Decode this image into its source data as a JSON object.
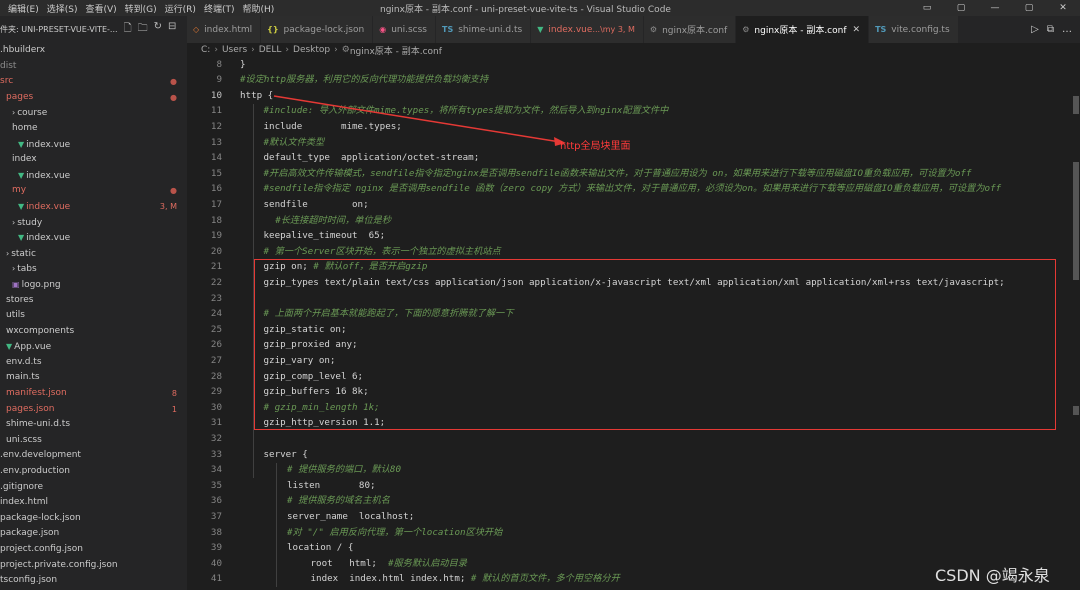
{
  "menu": [
    "编辑(E)",
    "选择(S)",
    "查看(V)",
    "转到(G)",
    "运行(R)",
    "终端(T)",
    "帮助(H)"
  ],
  "window_title": "nginx原本 - 副本.conf - uni-preset-vue-vite-ts - Visual Studio Code",
  "window_controls": [
    "▭",
    "▢",
    "—",
    "▢",
    "✕"
  ],
  "explorer": {
    "header": "件夹: UNI-PRESET-VUE-VITE-...",
    "icons": [
      "new-file-icon",
      "new-folder-icon",
      "refresh-icon",
      "collapse-icon"
    ],
    "items": [
      {
        "label": ".hbuilderx",
        "indent": 0,
        "color": "#cccccc",
        "icon": "",
        "badge": ""
      },
      {
        "label": "dist",
        "indent": 0,
        "color": "#8c8c8c",
        "icon": "",
        "badge": ""
      },
      {
        "label": "src",
        "indent": 0,
        "color": "#e06c60",
        "icon": "",
        "badge": "●",
        "badge_color": "#b9534a"
      },
      {
        "label": "pages",
        "indent": 1,
        "color": "#e06c60",
        "icon": "",
        "badge": "●",
        "badge_color": "#b9534a"
      },
      {
        "label": "course",
        "indent": 2,
        "color": "#cccccc",
        "icon": "›",
        "badge": ""
      },
      {
        "label": "home",
        "indent": 2,
        "color": "#cccccc",
        "icon": "",
        "badge": ""
      },
      {
        "label": "index.vue",
        "indent": 3,
        "color": "#cccccc",
        "icon": "▼",
        "icon_color": "#42b883",
        "badge": ""
      },
      {
        "label": "index",
        "indent": 2,
        "color": "#cccccc",
        "icon": "",
        "badge": ""
      },
      {
        "label": "index.vue",
        "indent": 3,
        "color": "#cccccc",
        "icon": "▼",
        "icon_color": "#42b883",
        "badge": ""
      },
      {
        "label": "my",
        "indent": 2,
        "color": "#e06c60",
        "icon": "",
        "badge": "●",
        "badge_color": "#b9534a"
      },
      {
        "label": "index.vue",
        "indent": 3,
        "color": "#e06c60",
        "icon": "▼",
        "icon_color": "#42b883",
        "badge": "3, M",
        "badge_color": "#e06c60"
      },
      {
        "label": "study",
        "indent": 2,
        "color": "#cccccc",
        "icon": "›",
        "badge": ""
      },
      {
        "label": "index.vue",
        "indent": 3,
        "color": "#cccccc",
        "icon": "▼",
        "icon_color": "#42b883",
        "badge": ""
      },
      {
        "label": "static",
        "indent": 1,
        "color": "#cccccc",
        "icon": "›",
        "badge": ""
      },
      {
        "label": "tabs",
        "indent": 2,
        "color": "#cccccc",
        "icon": "›",
        "badge": ""
      },
      {
        "label": "logo.png",
        "indent": 2,
        "color": "#cccccc",
        "icon": "▣",
        "icon_color": "#a074c4",
        "badge": ""
      },
      {
        "label": "stores",
        "indent": 1,
        "color": "#cccccc",
        "icon": "",
        "badge": ""
      },
      {
        "label": "utils",
        "indent": 1,
        "color": "#cccccc",
        "icon": "",
        "badge": ""
      },
      {
        "label": "wxcomponents",
        "indent": 1,
        "color": "#cccccc",
        "icon": "",
        "badge": ""
      },
      {
        "label": "App.vue",
        "indent": 1,
        "color": "#cccccc",
        "icon": "▼",
        "icon_color": "#42b883",
        "badge": ""
      },
      {
        "label": "env.d.ts",
        "indent": 1,
        "color": "#cccccc",
        "icon": "",
        "badge": ""
      },
      {
        "label": "main.ts",
        "indent": 1,
        "color": "#cccccc",
        "icon": "",
        "badge": ""
      },
      {
        "label": "manifest.json",
        "indent": 1,
        "color": "#e06c60",
        "icon": "",
        "badge": "8",
        "badge_color": "#e06c60"
      },
      {
        "label": "pages.json",
        "indent": 1,
        "color": "#e06c60",
        "icon": "",
        "badge": "1",
        "badge_color": "#e06c60"
      },
      {
        "label": "shime-uni.d.ts",
        "indent": 1,
        "color": "#cccccc",
        "icon": "",
        "badge": ""
      },
      {
        "label": "uni.scss",
        "indent": 1,
        "color": "#cccccc",
        "icon": "",
        "badge": ""
      },
      {
        "label": ".env.development",
        "indent": 0,
        "color": "#cccccc",
        "icon": "",
        "badge": ""
      },
      {
        "label": ".env.production",
        "indent": 0,
        "color": "#cccccc",
        "icon": "",
        "badge": ""
      },
      {
        "label": ".gitignore",
        "indent": 0,
        "color": "#cccccc",
        "icon": "",
        "badge": ""
      },
      {
        "label": "index.html",
        "indent": 0,
        "color": "#cccccc",
        "icon": "",
        "badge": ""
      },
      {
        "label": "package-lock.json",
        "indent": 0,
        "color": "#cccccc",
        "icon": "",
        "badge": ""
      },
      {
        "label": "package.json",
        "indent": 0,
        "color": "#cccccc",
        "icon": "",
        "badge": ""
      },
      {
        "label": "project.config.json",
        "indent": 0,
        "color": "#cccccc",
        "icon": "",
        "badge": ""
      },
      {
        "label": "project.private.config.json",
        "indent": 0,
        "color": "#cccccc",
        "icon": "",
        "badge": ""
      },
      {
        "label": "tsconfig.json",
        "indent": 0,
        "color": "#cccccc",
        "icon": "",
        "badge": ""
      }
    ]
  },
  "tabs": [
    {
      "label": "index.html",
      "icon": "◇",
      "icon_color": "#e37933",
      "active": false,
      "label_color": "#9d9d9d",
      "suffix": ""
    },
    {
      "label": "package-lock.json",
      "icon": "{}",
      "icon_color": "#cbcb41",
      "active": false,
      "label_color": "#9d9d9d",
      "suffix": ""
    },
    {
      "label": "uni.scss",
      "icon": "◉",
      "icon_color": "#f55385",
      "active": false,
      "label_color": "#9d9d9d",
      "suffix": ""
    },
    {
      "label": "shime-uni.d.ts",
      "icon": "TS",
      "icon_color": "#519aba",
      "active": false,
      "label_color": "#9d9d9d",
      "suffix": ""
    },
    {
      "label": "index.vue",
      "icon": "▼",
      "icon_color": "#42b883",
      "active": false,
      "label_color": "#e06c60",
      "suffix": "...\\my 3, M"
    },
    {
      "label": "nginx原本.conf",
      "icon": "⚙",
      "icon_color": "#8c8c8c",
      "active": false,
      "label_color": "#9d9d9d",
      "suffix": ""
    },
    {
      "label": "nginx原本 - 副本.conf",
      "icon": "⚙",
      "icon_color": "#8c8c8c",
      "active": true,
      "label_color": "#ffffff",
      "suffix": ""
    },
    {
      "label": "vite.config.ts",
      "icon": "TS",
      "icon_color": "#519aba",
      "active": false,
      "label_color": "#9d9d9d",
      "suffix": ""
    }
  ],
  "tab_actions": [
    "▷",
    "⧉",
    "…"
  ],
  "breadcrumb": [
    "C:",
    "Users",
    "DELL",
    "Desktop",
    "nginx原本 - 副本.conf"
  ],
  "breadcrumb_icon": "⚙",
  "code_lines": [
    {
      "n": "8",
      "text": "}",
      "cls": "k",
      "indent": 0
    },
    {
      "n": "9",
      "text": "#设定http服务器，利用它的反向代理功能提供负载均衡支持",
      "cls": "c",
      "indent": 0
    },
    {
      "n": "10",
      "text": "http {",
      "cls": "k",
      "indent": 0
    },
    {
      "n": "11",
      "text": "#include: 导入外部文件mime.types，将所有types提取为文件，然后导入到nginx配置文件中",
      "cls": "c",
      "indent": 1
    },
    {
      "n": "12",
      "text": "include       mime.types;",
      "cls": "k",
      "indent": 1
    },
    {
      "n": "13",
      "text": "#默认文件类型",
      "cls": "c",
      "indent": 1
    },
    {
      "n": "14",
      "text": "default_type  application/octet-stream;",
      "cls": "k",
      "indent": 1
    },
    {
      "n": "15",
      "text": "#开启高效文件传输模式，sendfile指令指定nginx是否调用sendfile函数来输出文件，对于普通应用设为 on，如果用来进行下载等应用磁盘IO重负载应用，可设置为off",
      "cls": "c",
      "indent": 1
    },
    {
      "n": "16",
      "text": "#sendfile指令指定 nginx 是否调用sendfile 函数（zero copy 方式）来输出文件，对于普通应用，必须设为on。如果用来进行下载等应用磁盘IO重负载应用，可设置为off",
      "cls": "c",
      "indent": 1
    },
    {
      "n": "17",
      "text": "sendfile        on;",
      "cls": "k",
      "indent": 1
    },
    {
      "n": "18",
      "text": "#长连接超时时间，单位是秒",
      "cls": "c",
      "indent": 1.5
    },
    {
      "n": "19",
      "text": "keepalive_timeout  65;",
      "cls": "k",
      "indent": 1
    },
    {
      "n": "20",
      "text": "# 第一个Server区块开始，表示一个独立的虚拟主机站点",
      "cls": "c",
      "indent": 1
    },
    {
      "n": "21",
      "text": "gzip on; # 默认off，是否开启gzip",
      "cls": "k",
      "indent": 1,
      "comment_at": 9
    },
    {
      "n": "22",
      "text": "gzip_types text/plain text/css application/json application/x-javascript text/xml application/xml application/xml+rss text/javascript;",
      "cls": "k",
      "indent": 1
    },
    {
      "n": "23",
      "text": "",
      "cls": "k",
      "indent": 1
    },
    {
      "n": "24",
      "text": "# 上面两个开启基本就能跑起了，下面的愿意折腾就了解一下",
      "cls": "c",
      "indent": 1
    },
    {
      "n": "25",
      "text": "gzip_static on;",
      "cls": "k",
      "indent": 1
    },
    {
      "n": "26",
      "text": "gzip_proxied any;",
      "cls": "k",
      "indent": 1
    },
    {
      "n": "27",
      "text": "gzip_vary on;",
      "cls": "k",
      "indent": 1
    },
    {
      "n": "28",
      "text": "gzip_comp_level 6;",
      "cls": "k",
      "indent": 1
    },
    {
      "n": "29",
      "text": "gzip_buffers 16 8k;",
      "cls": "k",
      "indent": 1
    },
    {
      "n": "30",
      "text": "# gzip_min_length 1k;",
      "cls": "c",
      "indent": 1
    },
    {
      "n": "31",
      "text": "gzip_http_version 1.1;",
      "cls": "k",
      "indent": 1
    },
    {
      "n": "32",
      "text": "",
      "cls": "k",
      "indent": 1
    },
    {
      "n": "33",
      "text": "server {",
      "cls": "k",
      "indent": 1
    },
    {
      "n": "34",
      "text": "# 提供服务的端口，默认80",
      "cls": "c",
      "indent": 2
    },
    {
      "n": "35",
      "text": "listen       80;",
      "cls": "k",
      "indent": 2
    },
    {
      "n": "36",
      "text": "# 提供服务的域名主机名",
      "cls": "c",
      "indent": 2
    },
    {
      "n": "37",
      "text": "server_name  localhost;",
      "cls": "k",
      "indent": 2
    },
    {
      "n": "38",
      "text": "#对 \"/\" 启用反向代理，第一个location区块开始",
      "cls": "c",
      "indent": 2
    },
    {
      "n": "39",
      "text": "location / {",
      "cls": "k",
      "indent": 2
    },
    {
      "n": "40",
      "text": "root   html;  #服务默认启动目录",
      "cls": "k",
      "indent": 3,
      "comment_at": 14
    },
    {
      "n": "41",
      "text": "index  index.html index.htm; # 默认的首页文件，多个用空格分开",
      "cls": "k",
      "indent": 3,
      "comment_at": 29
    }
  ],
  "current_line": "10",
  "annotation": {
    "label": "http全局块里面",
    "color": "#ff3b3b"
  },
  "watermark": "CSDN @竭永泉",
  "colors": {
    "comment": "#6a9955",
    "text": "#d4d4d4",
    "highlight_box": "#e53935",
    "modified": "#e06c60"
  }
}
